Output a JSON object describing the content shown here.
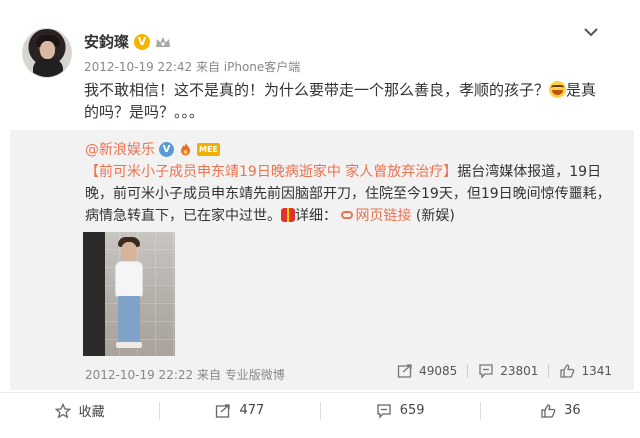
{
  "post": {
    "author_name": "安鈞璨",
    "meta": "2012-10-19 22:42 来自 iPhone客户端",
    "text_before_emoji": "我不敢相信！这不是真的！为什么要带走一个那么善良，孝顺的孩子？",
    "text_after_emoji": "是真的吗？是吗？。。。"
  },
  "repost": {
    "author_name": "@新浪娱乐",
    "vip_label": "MEE",
    "headline": "【前可米小子成员申东靖19日晚病逝家中 家人曾放弃治疗】",
    "body": "据台湾媒体报道，19日晚，前可米小子成员申东靖先前因脑部开刀，住院至今19天，但19日晚间惊传噩耗，病情急转直下，已在家中过世。",
    "detail_label": "详细：",
    "link_label": "网页链接",
    "source": "(新娱)",
    "meta": "2012-10-19 22:22 来自 专业版微博",
    "stats": {
      "reposts": "49085",
      "comments": "23801",
      "likes": "1341"
    }
  },
  "actions": {
    "favorite_label": "收藏",
    "repost_count": "477",
    "comment_count": "659",
    "like_count": "36"
  },
  "colors": {
    "accent": "#eb7350",
    "repost_bg": "#f2f2f2",
    "verified": "#f5b400"
  }
}
